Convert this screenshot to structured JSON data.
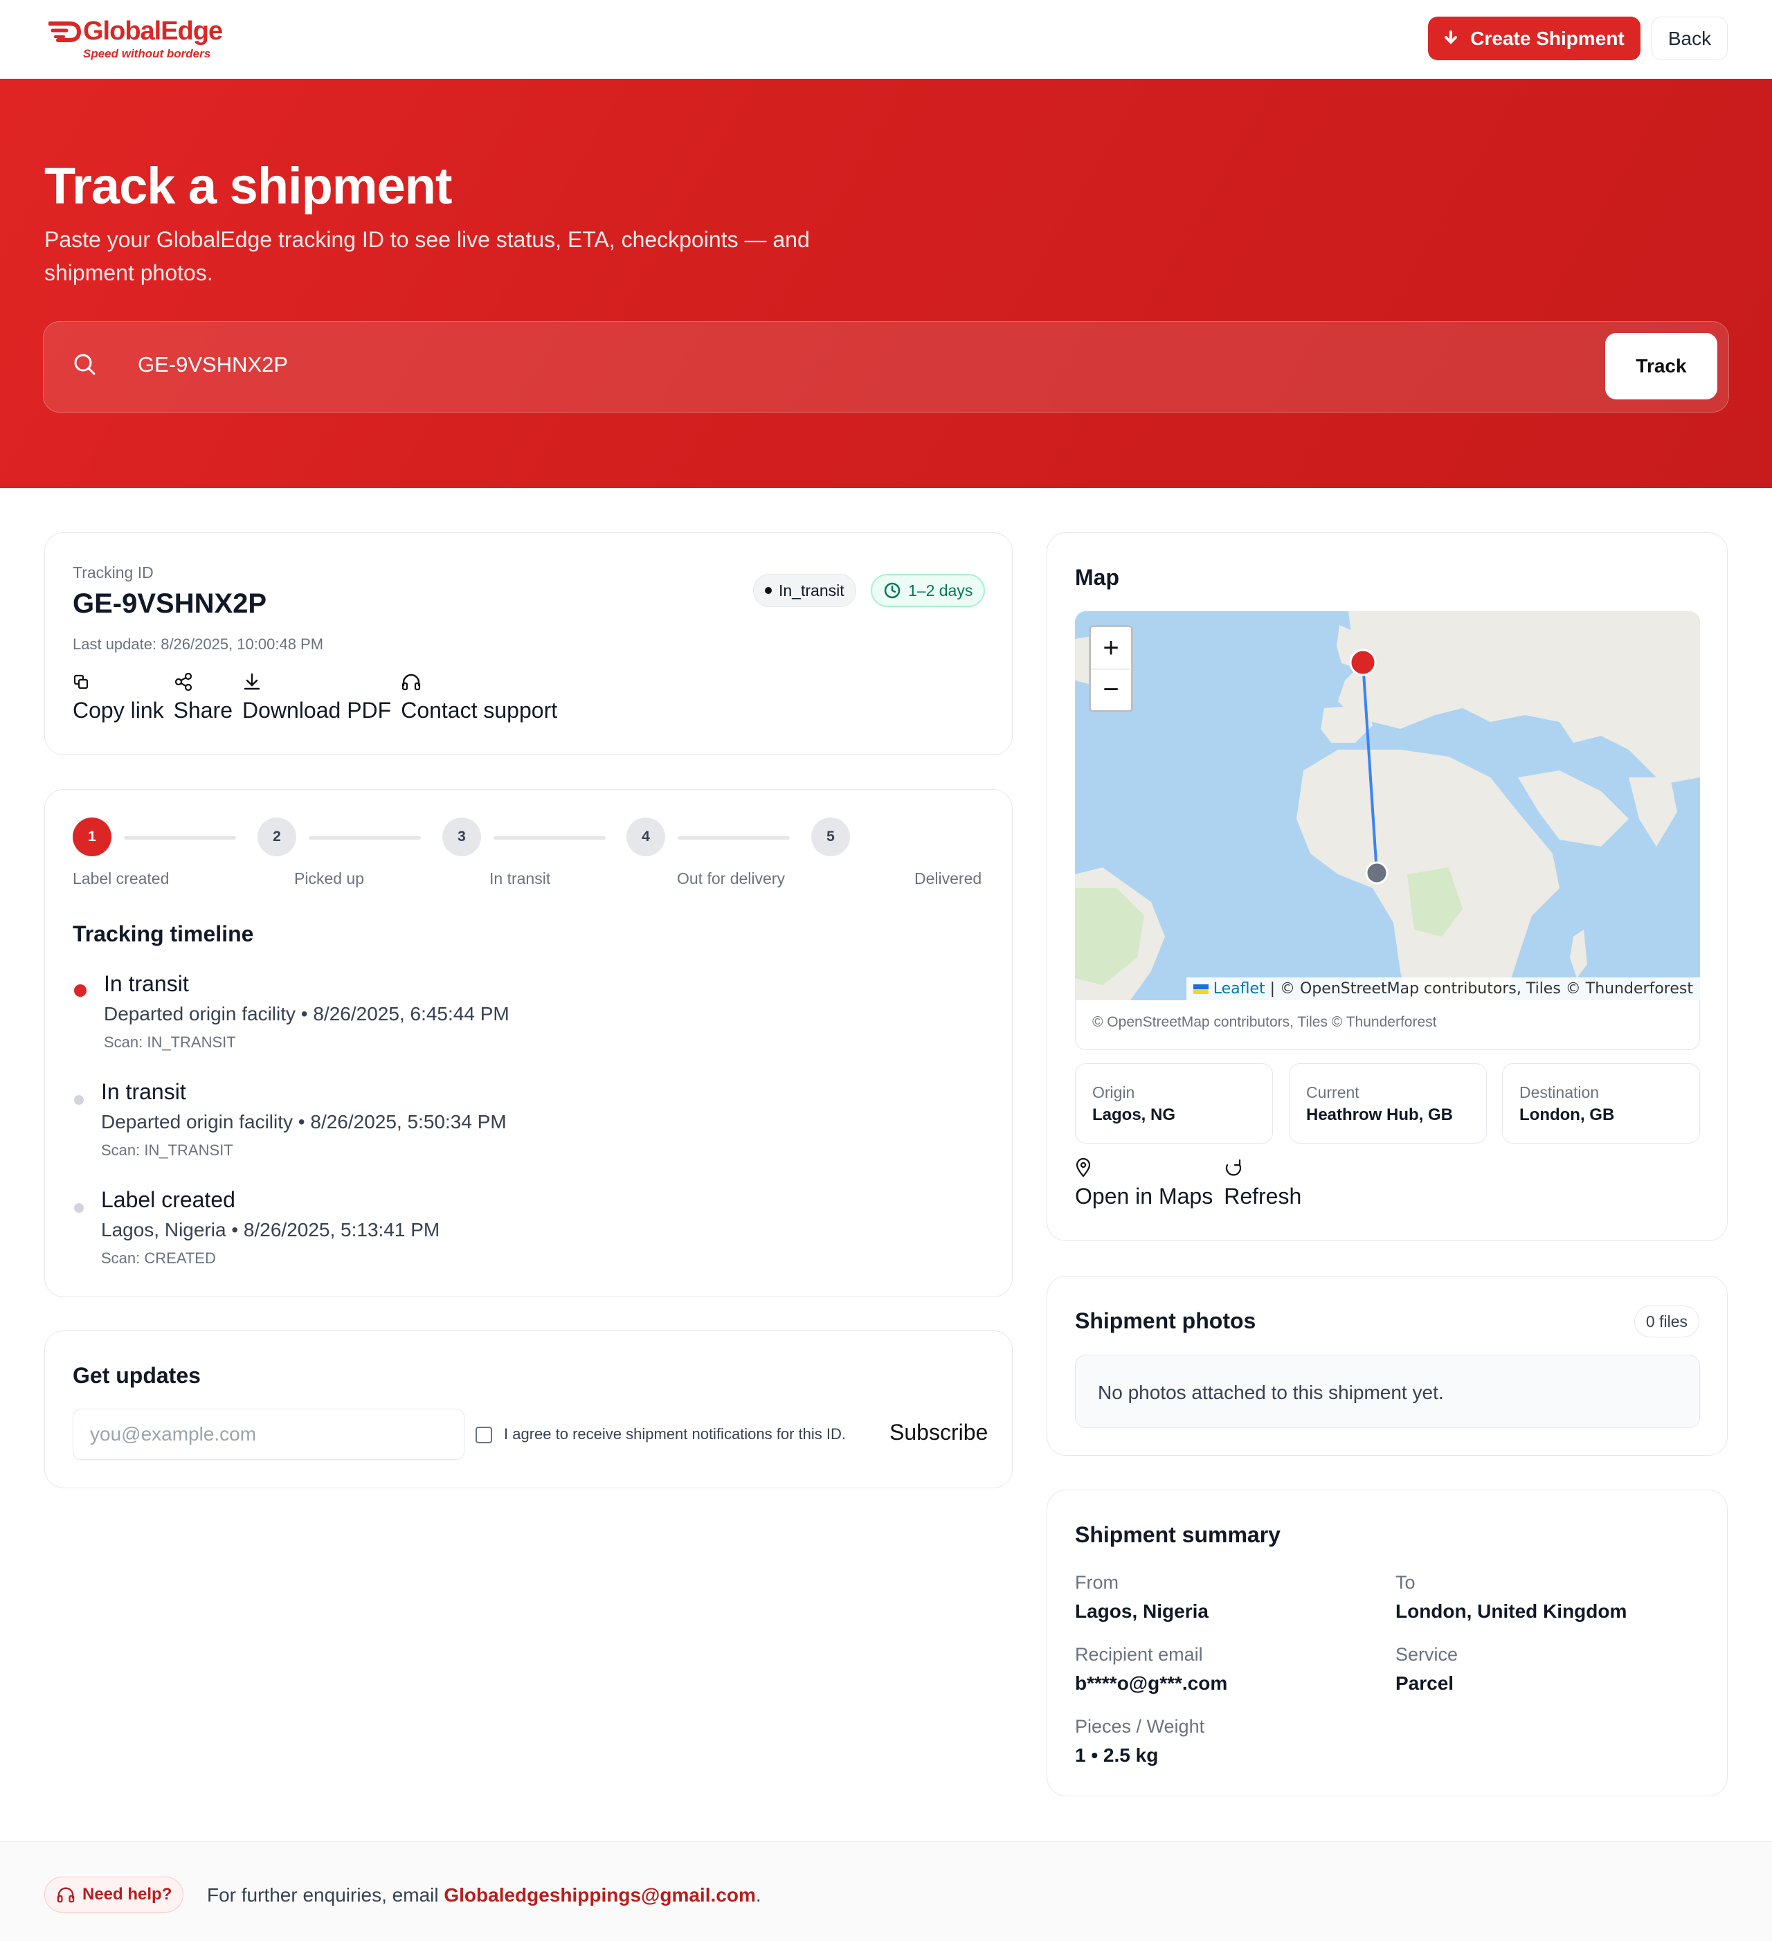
{
  "brand": {
    "name": "GlobalEdge",
    "tagline": "Speed without borders",
    "color": "#dc2626"
  },
  "header": {
    "create_label": "Create Shipment",
    "back_label": "Back"
  },
  "hero": {
    "title": "Track a shipment",
    "subtitle": "Paste your GlobalEdge tracking ID to see live status, ETA, checkpoints — and shipment photos.",
    "search_value": "GE-9VSHNX2P",
    "track_label": "Track"
  },
  "tracking": {
    "id_label": "Tracking ID",
    "id": "GE-9VSHNX2P",
    "last_update": "Last update: 8/26/2025, 10:00:48 PM",
    "status": "In_transit",
    "eta": "1–2 days",
    "actions": [
      "Copy link",
      "Share",
      "Download PDF",
      "Contact support"
    ]
  },
  "progress": {
    "current_step": 1,
    "steps": [
      {
        "num": "1",
        "label": "Label created"
      },
      {
        "num": "2",
        "label": "Picked up"
      },
      {
        "num": "3",
        "label": "In transit"
      },
      {
        "num": "4",
        "label": "Out for delivery"
      },
      {
        "num": "5",
        "label": "Delivered"
      }
    ]
  },
  "timeline": {
    "title": "Tracking timeline",
    "events": [
      {
        "title": "In transit",
        "detail": "Departed origin facility • 8/26/2025, 6:45:44 PM",
        "scan": "Scan: IN_TRANSIT"
      },
      {
        "title": "In transit",
        "detail": "Departed origin facility • 8/26/2025, 5:50:34 PM",
        "scan": "Scan: IN_TRANSIT"
      },
      {
        "title": "Label created",
        "detail": "Lagos, Nigeria • 8/26/2025, 5:13:41 PM",
        "scan": "Scan: CREATED"
      }
    ]
  },
  "updates": {
    "title": "Get updates",
    "email_placeholder": "you@example.com",
    "consent": "I agree to receive shipment notifications for this ID.",
    "subscribe_label": "Subscribe"
  },
  "map": {
    "title": "Map",
    "zoom_in": "+",
    "zoom_out": "−",
    "attribution_link": "Leaflet",
    "attribution_rest": " | © OpenStreetMap contributors, Tiles © Thunderforest",
    "footer_attribution": "© OpenStreetMap contributors, Tiles © Thunderforest",
    "origin": {
      "label": "Origin",
      "value": "Lagos, NG"
    },
    "current": {
      "label": "Current",
      "value": "Heathrow Hub, GB"
    },
    "destination": {
      "label": "Destination",
      "value": "London, GB"
    },
    "open_label": "Open in Maps",
    "refresh_label": "Refresh"
  },
  "photos": {
    "title": "Shipment photos",
    "count": "0 files",
    "empty": "No photos attached to this shipment yet."
  },
  "summary": {
    "title": "Shipment summary",
    "from_label": "From",
    "from": "Lagos, Nigeria",
    "to_label": "To",
    "to": "London, United Kingdom",
    "email_label": "Recipient email",
    "email": "b****o@g***.com",
    "service_label": "Service",
    "service": "Parcel",
    "pieces_label": "Pieces / Weight",
    "pieces": "1 • 2.5 kg"
  },
  "footer": {
    "help_label": "Need help?",
    "enquiry_text": "For further enquiries, email ",
    "email": "Globaledgeshippings@gmail.com",
    "period": "."
  }
}
